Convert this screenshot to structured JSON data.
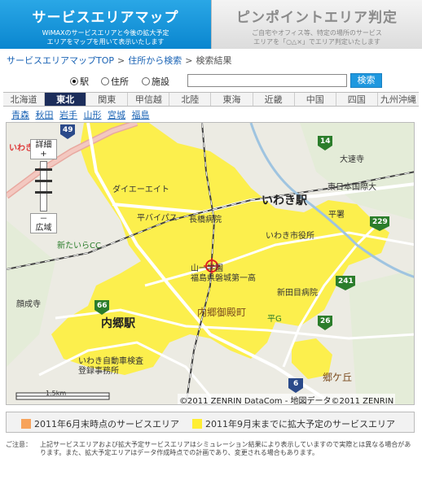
{
  "tabs": {
    "active": {
      "title": "サービスエリアマップ",
      "sub_line1": "WiMAXのサービスエリアと今後の拡大予定",
      "sub_line2": "エリアをマップを用いて表示いたします"
    },
    "inactive": {
      "title": "ピンポイントエリア判定",
      "sub_line1": "ご自宅やオフィス等、特定の場所のサービス",
      "sub_line2": "エリアを「○△×」でエリア判定いたします"
    }
  },
  "breadcrumb": {
    "items": [
      "サービスエリアマップTOP",
      "住所から検索",
      "検索結果"
    ],
    "separator": ">"
  },
  "search": {
    "options": [
      "駅",
      "住所",
      "施設"
    ],
    "selected": "駅",
    "value": "",
    "button_label": "検索"
  },
  "regions": {
    "items": [
      "北海道",
      "東北",
      "関東",
      "甲信越",
      "北陸",
      "東海",
      "近畿",
      "中国",
      "四国",
      "九州沖縄"
    ],
    "active": "東北"
  },
  "prefectures": [
    "青森",
    "秋田",
    "岩手",
    "山形",
    "宮城",
    "福島"
  ],
  "map": {
    "zoom_in_label": "詳細",
    "zoom_in_symbol": "+",
    "zoom_out_symbol": "－",
    "zoom_out_label": "広域",
    "scale_label": "1.5km",
    "copyright": "©2011 ZENRIN DataCom - 地図データ©2011 ZENRIN",
    "labels": {
      "iwaki_eki": "いわき駅",
      "uchigo_eki": "内郷駅",
      "iwaki_shiyakusho": "いわき市役所",
      "taira_bypass": "平バイパス",
      "nagahashi_hospital": "長橋病院",
      "daiei": "ダイエーエイト",
      "shintaira_cc": "新たいらCC",
      "fukushima_ken": "福島県磐城第一高",
      "yama_sakura": "山一学園",
      "uchigo_goten": "内郷御殿町",
      "shinden_hospital": "新田目病院",
      "taira_sho": "平署",
      "otowa": "大速寺",
      "higashi_nihon": "東日本国際大",
      "kyo_go": "郷ケ丘",
      "iwaki_car": "いわき自動車検査",
      "toroku": "登録事務所",
      "iwaki_sanku": "いわき",
      "kenteki": "顔成寺",
      "taira_g": "平G",
      "route_49": "49",
      "route_66": "66",
      "route_6": "6",
      "route_26": "26",
      "route_229": "229",
      "route_241": "241",
      "route_14": "14"
    },
    "colors": {
      "coverage_current": "#f7a35c",
      "coverage_planned": "#ffee33"
    }
  },
  "legend": {
    "current": "2011年6月末時点のサービスエリア",
    "planned": "2011年9月末までに拡大予定のサービスエリア"
  },
  "note": {
    "label": "ご注意：",
    "text": "上記サービスエリアおよび拡大予定サービスエリアはシミュレーション結果により表示していますので実際とは異なる場合があります。また、拡大予定エリアはデータ作成時点での計画であり、変更される場合もあります。"
  }
}
